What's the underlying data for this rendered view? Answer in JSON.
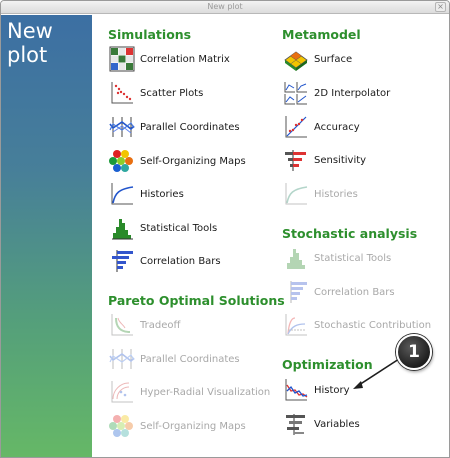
{
  "window": {
    "title": "New plot",
    "close_glyph": "×"
  },
  "sidebar": {
    "title": "New plot"
  },
  "sections": {
    "simulations": {
      "title": "Simulations",
      "items": [
        {
          "label": "Correlation Matrix",
          "icon": "correlation-matrix-icon"
        },
        {
          "label": "Scatter Plots",
          "icon": "scatter-plots-icon"
        },
        {
          "label": "Parallel Coordinates",
          "icon": "parallel-coordinates-icon"
        },
        {
          "label": "Self-Organizing Maps",
          "icon": "self-organizing-maps-icon"
        },
        {
          "label": "Histories",
          "icon": "histories-icon"
        },
        {
          "label": "Statistical Tools",
          "icon": "statistical-tools-icon"
        },
        {
          "label": "Correlation Bars",
          "icon": "correlation-bars-icon"
        }
      ]
    },
    "pareto": {
      "title": "Pareto Optimal Solutions",
      "items": [
        {
          "label": "Tradeoff",
          "icon": "tradeoff-icon",
          "enabled": false
        },
        {
          "label": "Parallel Coordinates",
          "icon": "parallel-coordinates-icon",
          "enabled": false
        },
        {
          "label": "Hyper-Radial Visualization",
          "icon": "hyper-radial-icon",
          "enabled": false
        },
        {
          "label": "Self-Organizing Maps",
          "icon": "self-organizing-maps-icon",
          "enabled": false
        }
      ]
    },
    "metamodel": {
      "title": "Metamodel",
      "items": [
        {
          "label": "Surface",
          "icon": "surface-icon"
        },
        {
          "label": "2D Interpolator",
          "icon": "2d-interpolator-icon"
        },
        {
          "label": "Accuracy",
          "icon": "accuracy-icon"
        },
        {
          "label": "Sensitivity",
          "icon": "sensitivity-icon"
        },
        {
          "label": "Histories",
          "icon": "histories-icon",
          "enabled": false
        }
      ]
    },
    "stochastic": {
      "title": "Stochastic analysis",
      "items": [
        {
          "label": "Statistical Tools",
          "icon": "statistical-tools-icon",
          "enabled": false
        },
        {
          "label": "Correlation Bars",
          "icon": "correlation-bars-icon",
          "enabled": false
        },
        {
          "label": "Stochastic Contribution",
          "icon": "stochastic-contribution-icon",
          "enabled": false
        }
      ]
    },
    "optimization": {
      "title": "Optimization",
      "items": [
        {
          "label": "History",
          "icon": "history-icon"
        },
        {
          "label": "Variables",
          "icon": "variables-icon"
        }
      ]
    }
  },
  "callout": {
    "number": "1"
  },
  "colors": {
    "section_title": "#2d8f2d",
    "disabled_text": "#a8a8a8",
    "sidebar_top": "#3c6fa3",
    "sidebar_bottom": "#66b866"
  }
}
